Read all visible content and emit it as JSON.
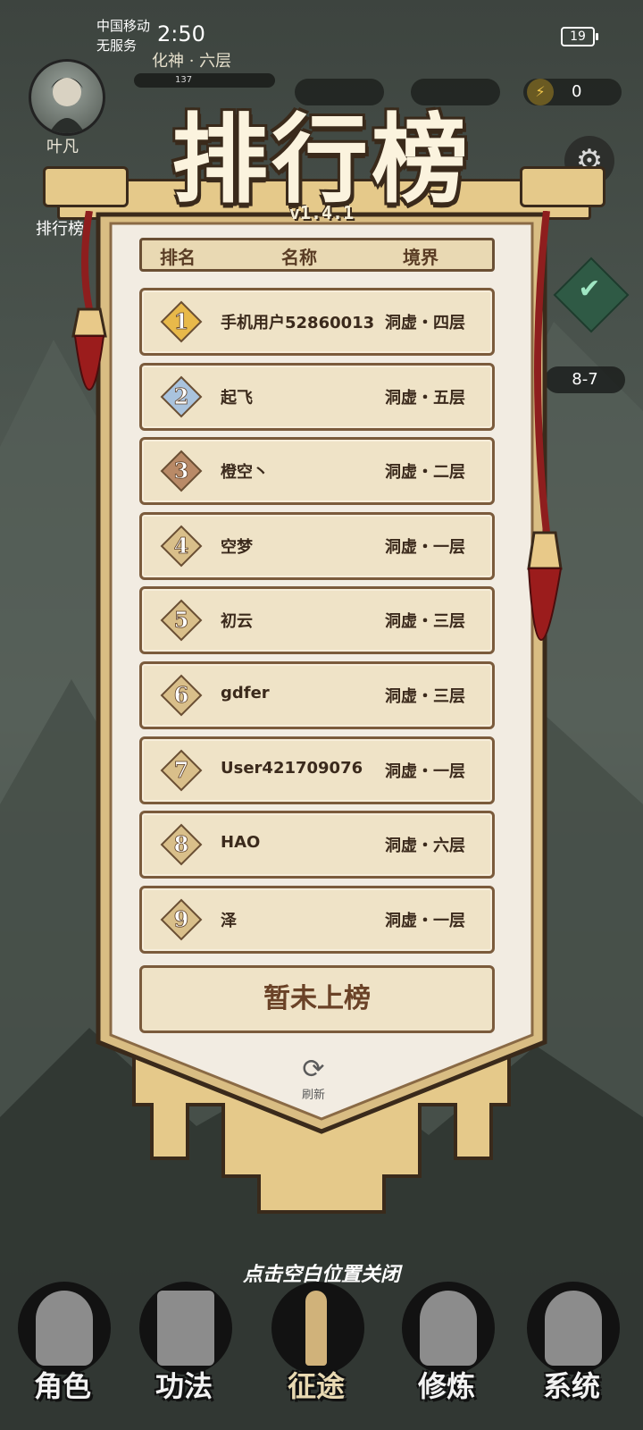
{
  "status_bar": {
    "carrier": "中国移动",
    "service": "无服务",
    "time": "2:50",
    "battery": "19"
  },
  "hud": {
    "player_name": "叶凡",
    "player_realm": "化神 · 六层",
    "exp_text": "137",
    "energy_value": "0",
    "stage": "8-7",
    "side_label": "排行榜"
  },
  "leaderboard": {
    "title": "排行榜",
    "version": "v1.4.1",
    "headers": {
      "rank": "排名",
      "name": "名称",
      "realm": "境界"
    },
    "rows": [
      {
        "rank": "1",
        "name": "手机用户52860013",
        "realm": "洞虚・四层"
      },
      {
        "rank": "2",
        "name": "起飞",
        "realm": "洞虚・五层"
      },
      {
        "rank": "3",
        "name": "橙空丶",
        "realm": "洞虚・二层"
      },
      {
        "rank": "4",
        "name": "空梦",
        "realm": "洞虚・一层"
      },
      {
        "rank": "5",
        "name": "初云",
        "realm": "洞虚・三层"
      },
      {
        "rank": "6",
        "name": "gdfer",
        "realm": "洞虚・三层"
      },
      {
        "rank": "7",
        "name": "User421709076",
        "realm": "洞虚・一层"
      },
      {
        "rank": "8",
        "name": "HAO",
        "realm": "洞虚・六层"
      },
      {
        "rank": "9",
        "name": "泽",
        "realm": "洞虚・一层"
      }
    ],
    "self_status": "暂未上榜",
    "refresh_label": "刷新",
    "close_hint": "点击空白位置关闭"
  },
  "bottom_nav": [
    {
      "label": "角色",
      "icon": "character-icon"
    },
    {
      "label": "功法",
      "icon": "book-icon"
    },
    {
      "label": "征途",
      "icon": "sword-icon"
    },
    {
      "label": "修炼",
      "icon": "meditate-icon"
    },
    {
      "label": "系统",
      "icon": "system-icon"
    }
  ],
  "colors": {
    "gold": "#e8b94a",
    "silver": "#a9c3de",
    "bronze": "#b98a67",
    "plain": "#d9bf8a",
    "tassel": "#9b1c1c"
  }
}
